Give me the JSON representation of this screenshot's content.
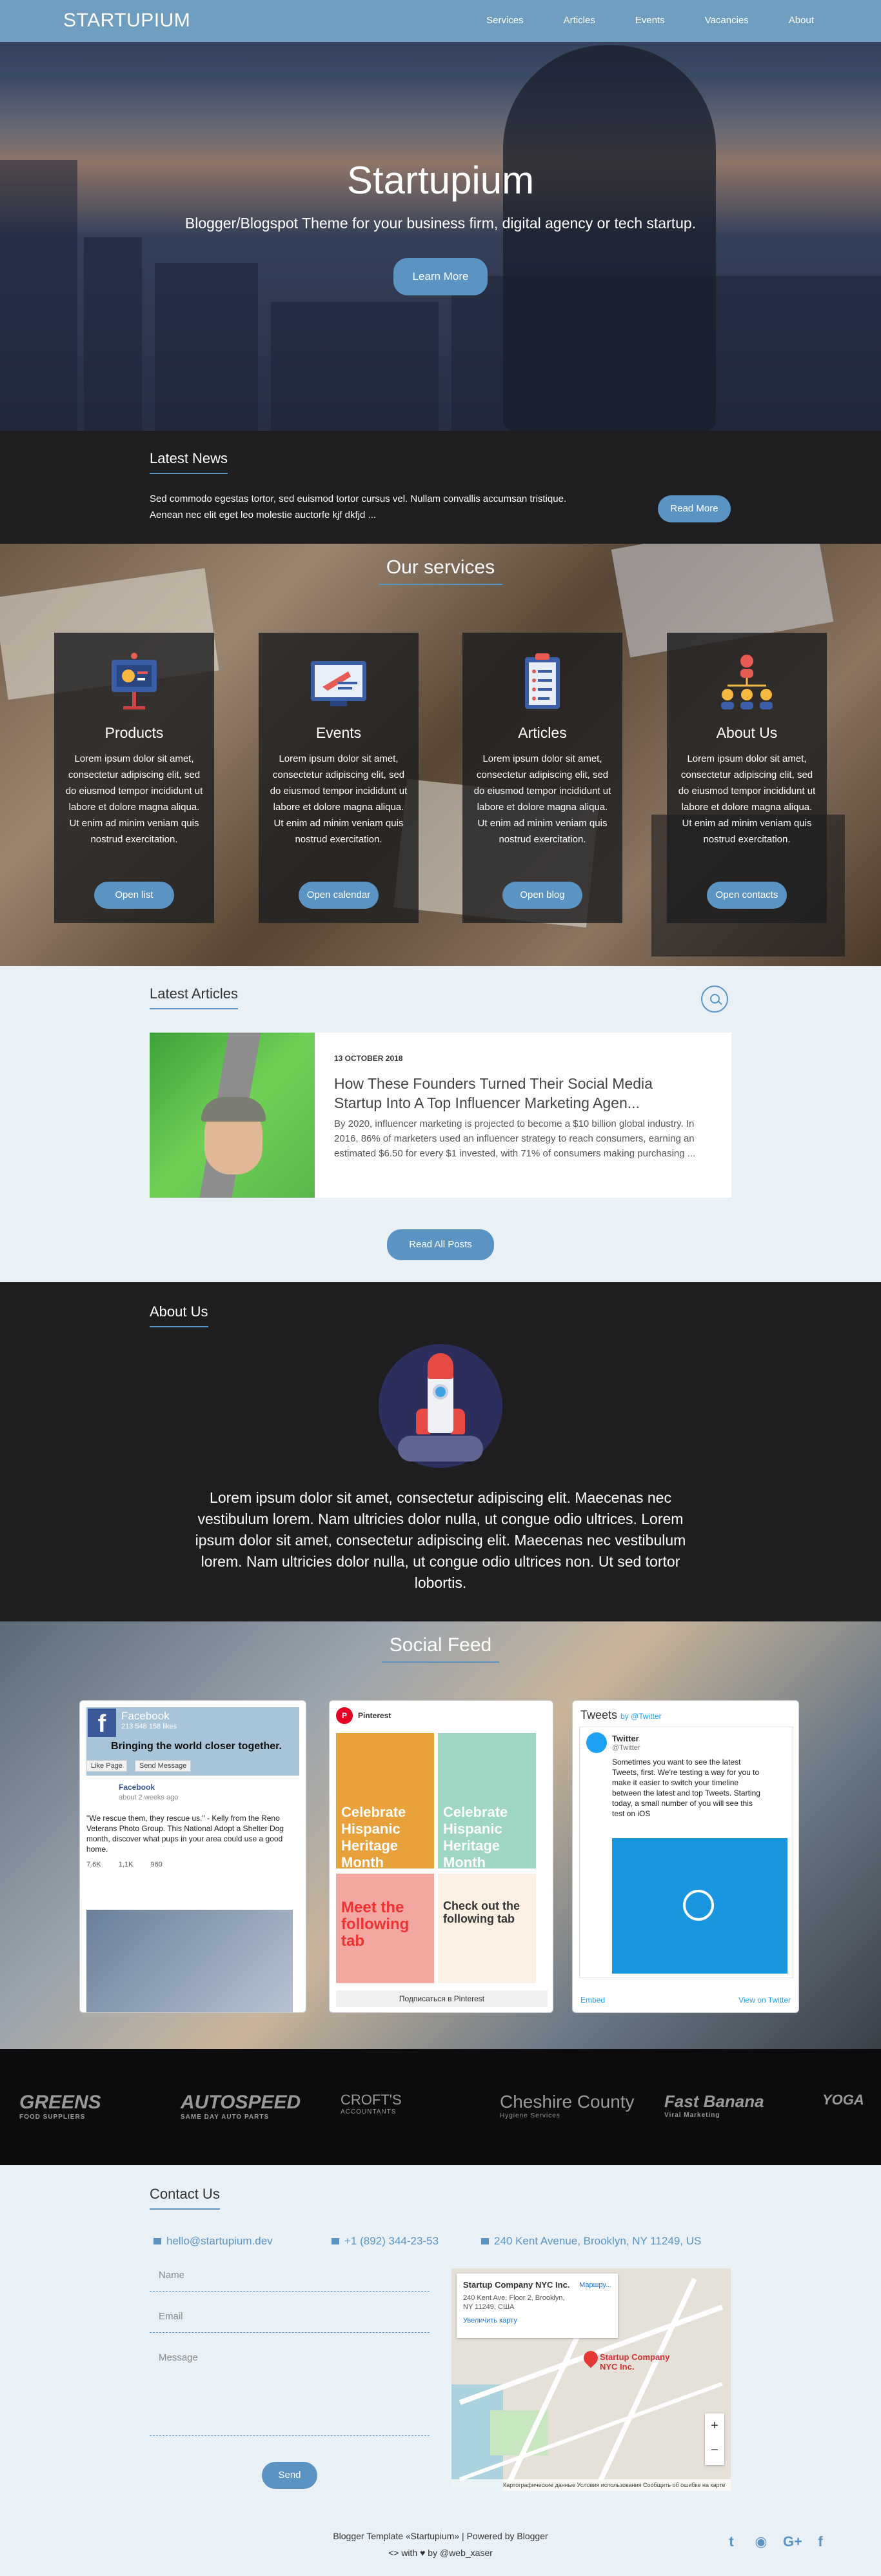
{
  "nav": {
    "brand": "STARTUPIUM",
    "links": [
      "Services",
      "Articles",
      "Events",
      "Vacancies",
      "About"
    ]
  },
  "hero": {
    "title": "Startupium",
    "subtitle": "Blogger/Blogspot Theme for your business firm, digital agency or tech startup.",
    "button": "Learn More"
  },
  "news": {
    "title": "Latest News",
    "text": "Sed commodo egestas tortor, sed euismod tortor cursus vel. Nullam convallis accumsan tristique. Aenean nec elit eget leo molestie auctorfe kjf dkfjd ...",
    "button": "Read More"
  },
  "services": {
    "title": "Our services",
    "cards": [
      {
        "title": "Products",
        "text": "Lorem ipsum dolor sit amet, consectetur adipiscing elit, sed do eiusmod tempor incididunt ut labore et dolore magna aliqua. Ut enim ad minim veniam quis nostrud exercitation.",
        "button": "Open list",
        "icon": "presentation-board-icon"
      },
      {
        "title": "Events",
        "text": "Lorem ipsum dolor sit amet, consectetur adipiscing elit, sed do eiusmod tempor incididunt ut labore et dolore magna aliqua. Ut enim ad minim veniam quis nostrud exercitation.",
        "button": "Open calendar",
        "icon": "rocket-screen-icon"
      },
      {
        "title": "Articles",
        "text": "Lorem ipsum dolor sit amet, consectetur adipiscing elit, sed do eiusmod tempor incididunt ut labore et dolore magna aliqua. Ut enim ad minim veniam quis nostrud exercitation.",
        "button": "Open blog",
        "icon": "checklist-icon"
      },
      {
        "title": "About Us",
        "text": "Lorem ipsum dolor sit amet, consectetur adipiscing elit, sed do eiusmod tempor incididunt ut labore et dolore magna aliqua. Ut enim ad minim veniam quis nostrud exercitation.",
        "button": "Open contacts",
        "icon": "team-hierarchy-icon"
      }
    ]
  },
  "articles": {
    "title": "Latest Articles",
    "post": {
      "date": "13 OCTOBER 2018",
      "title": "How These Founders Turned Their Social Media Startup Into A Top Influencer Marketing Agen...",
      "excerpt": "By 2020, influencer marketing is projected to become a $10 billion global industry. In 2016, 86% of marketers used an influencer strategy to reach consumers, earning an estimated $6.50 for every $1 invested, with 71% of consumers making purchasing ..."
    },
    "button": "Read All Posts"
  },
  "about": {
    "title": "About Us",
    "text": "Lorem ipsum dolor sit amet, consectetur adipiscing elit. Maecenas nec vestibulum lorem. Nam ultricies dolor nulla, ut congue odio ultrices. Lorem ipsum dolor sit amet, consectetur adipiscing elit. Maecenas nec vestibulum lorem. Nam ultricies dolor nulla, ut congue odio ultrices non. Ut sed tortor lobortis."
  },
  "social": {
    "title": "Social Feed",
    "facebook": {
      "name": "Facebook",
      "likes": "213 548 158 likes",
      "caption": "Bringing the world closer together.",
      "like_btn": "Like Page",
      "msg_btn": "Send Message",
      "post_name": "Facebook",
      "post_date": "about 2 weeks ago",
      "post_text": "\"We rescue them, they rescue us.\" - Kelly from the Reno Veterans Photo Group. This National Adopt a Shelter Dog month, discover what pups in your area could use a good home.",
      "reactions": "7.6K",
      "comments": "1,1K",
      "shares": "960"
    },
    "pinterest": {
      "name": "Pinterest",
      "tiles": [
        "Celebrate Hispanic Heritage Month",
        "Celebrate Hispanic Heritage Month",
        "Meet the following tab",
        "Check out the following tab"
      ],
      "follow": "Подписаться в Pinterest"
    },
    "twitter": {
      "header": "Tweets",
      "by": "by @Twitter",
      "user": "Twitter",
      "handle": "@Twitter",
      "text": "Sometimes you want to see the latest Tweets, first. We're testing a way for you to make it easier to switch your timeline between the latest and top Tweets. Starting today, a small number of you will see this test on iOS",
      "embed": "Embed",
      "view": "View on Twitter"
    }
  },
  "clients": [
    {
      "name": "GREENS",
      "sub": "FOOD SUPPLIERS"
    },
    {
      "name": "AUTOSPEED",
      "sub": "SAME DAY AUTO PARTS"
    },
    {
      "name": "CROFT'S",
      "sub": "ACCOUNTANTS"
    },
    {
      "name": "Cheshire County",
      "sub": "Hygiene Services"
    },
    {
      "name": "Fast Banana",
      "sub": "Viral Marketing"
    },
    {
      "name": "YOGA",
      "sub": ""
    }
  ],
  "contact": {
    "title": "Contact Us",
    "email": "hello@startupium.dev",
    "phone": "+1 (892) 344-23-53",
    "address": "240 Kent Avenue, Brooklyn, NY 11249, US",
    "name_ph": "Name",
    "email_ph": "Email",
    "message_ph": "Message",
    "button": "Send",
    "map": {
      "company": "Startup Company NYC Inc.",
      "addr": "240 Kent Ave, Floor 2, Brooklyn, NY 11249, США",
      "link": "Увеличить карту",
      "dir": "Маршру...",
      "pin_label": "Startup Company NYC Inc.",
      "bar": "Картографические данные  Условия использования  Сообщить об ошибке на карте"
    }
  },
  "footer": {
    "line1": "Blogger Template «Startupium» | Powered by Blogger",
    "line2": "<> with ♥ by @web_xaser"
  },
  "colors": {
    "accent": "#5b93c3",
    "dark": "#1e1e20",
    "light": "#e9f1f7"
  }
}
